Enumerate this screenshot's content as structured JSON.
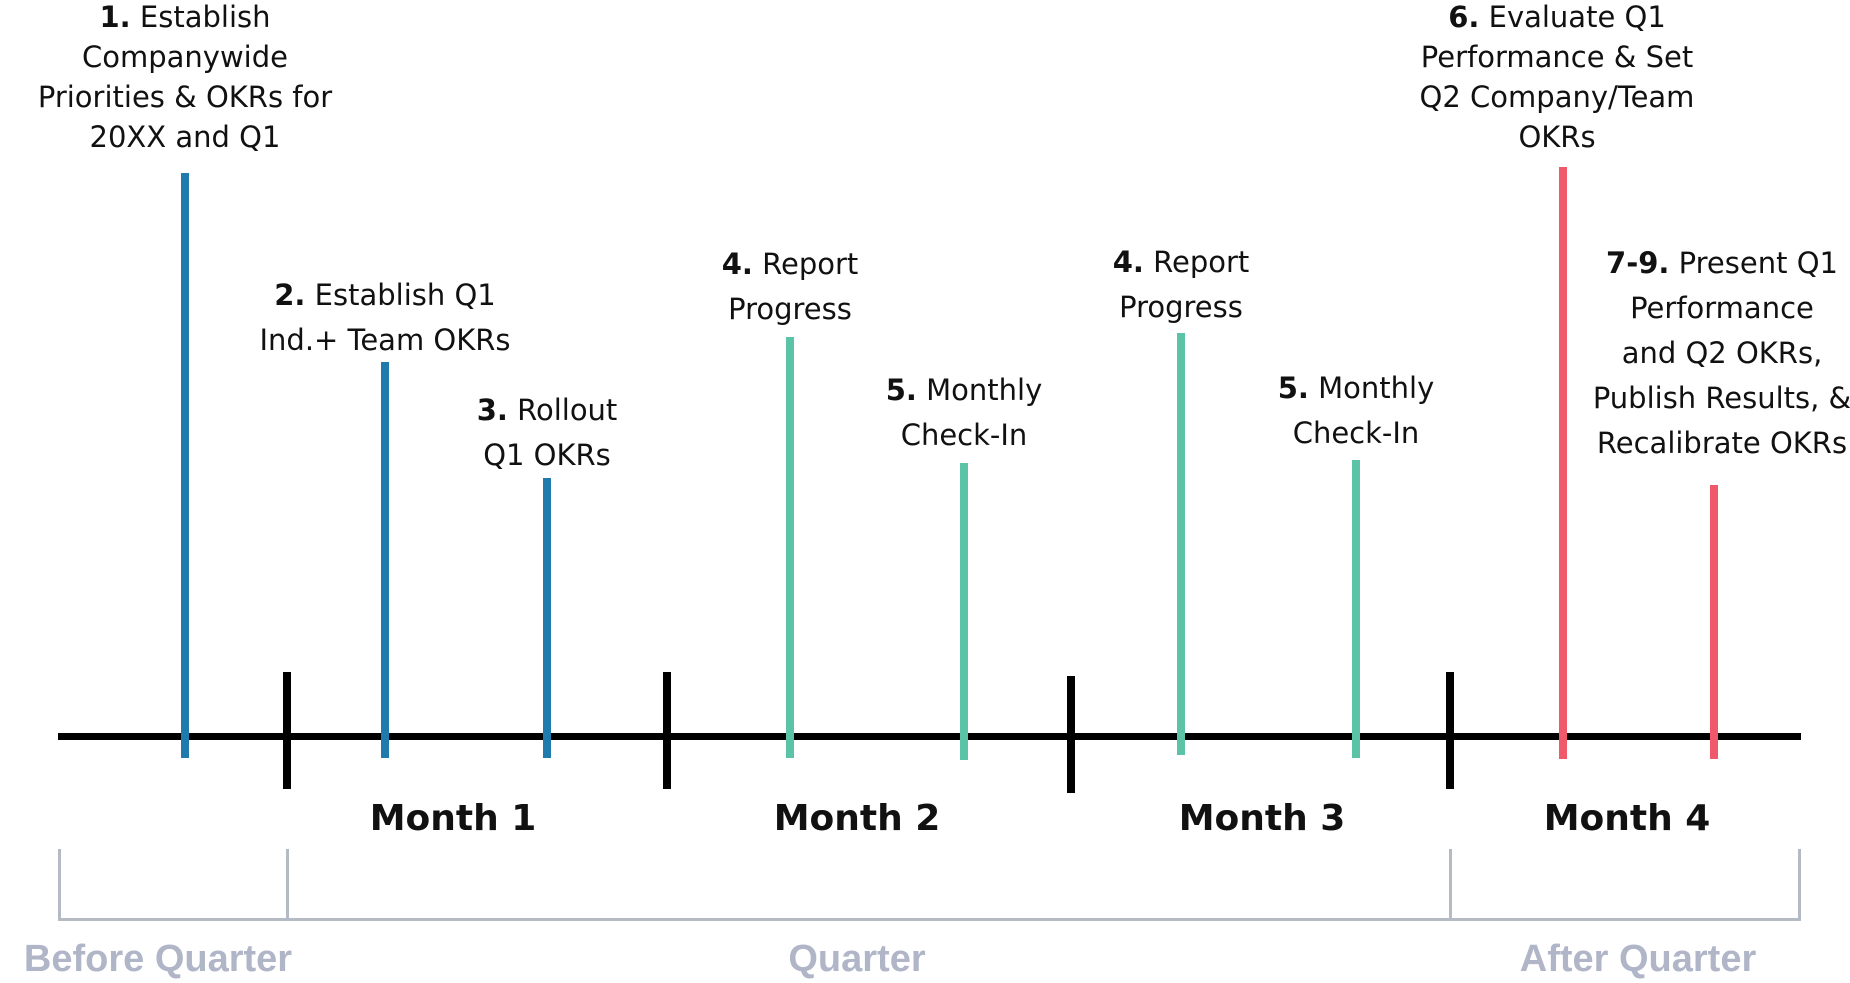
{
  "colors": {
    "before_quarter": "#1f7bab",
    "quarter": "#5cc4a6",
    "after_quarter": "#f0596a",
    "axis": "#000000",
    "bracket": "#b4bbc4",
    "phase_text": "#b0b6c8"
  },
  "steps": [
    {
      "num": "1.",
      "lines": [
        "Establish",
        "Companywide",
        "Priorities & OKRs for",
        "20XX and Q1"
      ]
    },
    {
      "num": "2.",
      "lines": [
        "Establish Q1",
        "Ind.+ Team OKRs"
      ]
    },
    {
      "num": "3.",
      "lines": [
        "Rollout",
        "Q1 OKRs"
      ]
    },
    {
      "num": "4.",
      "lines": [
        "Report",
        "Progress"
      ]
    },
    {
      "num": "5.",
      "lines": [
        "Monthly",
        "Check-In"
      ]
    },
    {
      "num": "4.",
      "lines": [
        "Report",
        "Progress"
      ]
    },
    {
      "num": "5.",
      "lines": [
        "Monthly",
        "Check-In"
      ]
    },
    {
      "num": "6.",
      "lines": [
        "Evaluate Q1",
        "Performance & Set",
        "Q2 Company/Team",
        "OKRs"
      ]
    },
    {
      "num": "7-9.",
      "lines": [
        "Present Q1",
        "Performance",
        "and Q2 OKRs,",
        "Publish Results, &",
        "Recalibrate OKRs"
      ]
    }
  ],
  "months": [
    "Month 1",
    "Month 2",
    "Month 3",
    "Month 4"
  ],
  "phases": [
    "Before Quarter",
    "Quarter",
    "After Quarter"
  ]
}
